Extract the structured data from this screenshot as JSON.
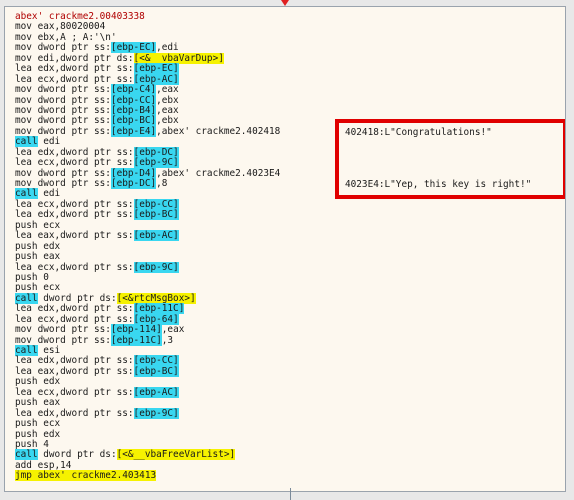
{
  "header": "abex' crackme2.00403338",
  "lines": [
    {
      "m": "mov",
      "parts": [
        {
          "t": " eax,80020004"
        }
      ]
    },
    {
      "m": "mov",
      "parts": [
        {
          "t": " ebx,A ; A:'\\n'"
        }
      ]
    },
    {
      "m": "mov",
      "parts": [
        {
          "t": " dword ptr ss:"
        },
        {
          "t": "[ebp-EC]",
          "c": "cyan"
        },
        {
          "t": ",edi"
        }
      ]
    },
    {
      "m": "mov",
      "parts": [
        {
          "t": " edi,dword ptr ds:"
        },
        {
          "t": "[<&__vbaVarDup>]",
          "c": "yellow"
        }
      ]
    },
    {
      "m": "lea",
      "parts": [
        {
          "t": " edx,dword ptr ss:"
        },
        {
          "t": "[ebp-EC]",
          "c": "cyan"
        }
      ]
    },
    {
      "m": "lea",
      "parts": [
        {
          "t": " ecx,dword ptr ss:"
        },
        {
          "t": "[ebp-AC]",
          "c": "cyan"
        }
      ]
    },
    {
      "m": "mov",
      "parts": [
        {
          "t": " dword ptr ss:"
        },
        {
          "t": "[ebp-C4]",
          "c": "cyan"
        },
        {
          "t": ",eax"
        }
      ]
    },
    {
      "m": "mov",
      "parts": [
        {
          "t": " dword ptr ss:"
        },
        {
          "t": "[ebp-CC]",
          "c": "cyan"
        },
        {
          "t": ",ebx"
        }
      ]
    },
    {
      "m": "mov",
      "parts": [
        {
          "t": " dword ptr ss:"
        },
        {
          "t": "[ebp-B4]",
          "c": "cyan"
        },
        {
          "t": ",eax"
        }
      ]
    },
    {
      "m": "mov",
      "parts": [
        {
          "t": " dword ptr ss:"
        },
        {
          "t": "[ebp-BC]",
          "c": "cyan"
        },
        {
          "t": ",ebx"
        }
      ]
    },
    {
      "m": "mov",
      "parts": [
        {
          "t": " dword ptr ss:"
        },
        {
          "t": "[ebp-E4]",
          "c": "cyan"
        },
        {
          "t": ",abex' crackme2.402418"
        }
      ],
      "comment": "402418:L\"Congratulations!\""
    },
    {
      "m": "call",
      "mc": "cyan",
      "parts": [
        {
          "t": " edi"
        }
      ]
    },
    {
      "m": "lea",
      "parts": [
        {
          "t": " edx,dword ptr ss:"
        },
        {
          "t": "[ebp-DC]",
          "c": "cyan"
        }
      ]
    },
    {
      "m": "lea",
      "parts": [
        {
          "t": " ecx,dword ptr ss:"
        },
        {
          "t": "[ebp-9C]",
          "c": "cyan"
        }
      ]
    },
    {
      "m": "mov",
      "parts": [
        {
          "t": " dword ptr ss:"
        },
        {
          "t": "[ebp-D4]",
          "c": "cyan"
        },
        {
          "t": ",abex' crackme2.4023E4"
        }
      ],
      "comment": "4023E4:L\"Yep, this key is right!\""
    },
    {
      "m": "mov",
      "parts": [
        {
          "t": " dword ptr ss:"
        },
        {
          "t": "[ebp-DC]",
          "c": "cyan"
        },
        {
          "t": ",8"
        }
      ]
    },
    {
      "m": "call",
      "mc": "cyan",
      "parts": [
        {
          "t": " edi"
        }
      ]
    },
    {
      "m": "lea",
      "parts": [
        {
          "t": " ecx,dword ptr ss:"
        },
        {
          "t": "[ebp-CC]",
          "c": "cyan"
        }
      ]
    },
    {
      "m": "lea",
      "parts": [
        {
          "t": " edx,dword ptr ss:"
        },
        {
          "t": "[ebp-BC]",
          "c": "cyan"
        }
      ]
    },
    {
      "m": "push",
      "parts": [
        {
          "t": " ecx"
        }
      ]
    },
    {
      "m": "lea",
      "parts": [
        {
          "t": " eax,dword ptr ss:"
        },
        {
          "t": "[ebp-AC]",
          "c": "cyan"
        }
      ]
    },
    {
      "m": "push",
      "parts": [
        {
          "t": " edx"
        }
      ]
    },
    {
      "m": "push",
      "parts": [
        {
          "t": " eax"
        }
      ]
    },
    {
      "m": "lea",
      "parts": [
        {
          "t": " ecx,dword ptr ss:"
        },
        {
          "t": "[ebp-9C]",
          "c": "cyan"
        }
      ]
    },
    {
      "m": "push",
      "parts": [
        {
          "t": " 0"
        }
      ]
    },
    {
      "m": "push",
      "parts": [
        {
          "t": " ecx"
        }
      ]
    },
    {
      "m": "call",
      "mc": "cyan",
      "parts": [
        {
          "t": " dword ptr ds:"
        },
        {
          "t": "[<&rtcMsgBox>]",
          "c": "yellow"
        }
      ]
    },
    {
      "m": "lea",
      "parts": [
        {
          "t": " edx,dword ptr ss:"
        },
        {
          "t": "[ebp-11C]",
          "c": "cyan"
        }
      ]
    },
    {
      "m": "lea",
      "parts": [
        {
          "t": " ecx,dword ptr ss:"
        },
        {
          "t": "[ebp-64]",
          "c": "cyan"
        }
      ]
    },
    {
      "m": "mov",
      "parts": [
        {
          "t": " dword ptr ss:"
        },
        {
          "t": "[ebp-114]",
          "c": "cyan"
        },
        {
          "t": ",eax"
        }
      ]
    },
    {
      "m": "mov",
      "parts": [
        {
          "t": " dword ptr ss:"
        },
        {
          "t": "[ebp-11C]",
          "c": "cyan"
        },
        {
          "t": ",3"
        }
      ]
    },
    {
      "m": "call",
      "mc": "cyan",
      "parts": [
        {
          "t": " esi"
        }
      ]
    },
    {
      "m": "lea",
      "parts": [
        {
          "t": " edx,dword ptr ss:"
        },
        {
          "t": "[ebp-CC]",
          "c": "cyan"
        }
      ]
    },
    {
      "m": "lea",
      "parts": [
        {
          "t": " eax,dword ptr ss:"
        },
        {
          "t": "[ebp-BC]",
          "c": "cyan"
        }
      ]
    },
    {
      "m": "push",
      "parts": [
        {
          "t": " edx"
        }
      ]
    },
    {
      "m": "lea",
      "parts": [
        {
          "t": " ecx,dword ptr ss:"
        },
        {
          "t": "[ebp-AC]",
          "c": "cyan"
        }
      ]
    },
    {
      "m": "push",
      "parts": [
        {
          "t": " eax"
        }
      ]
    },
    {
      "m": "lea",
      "parts": [
        {
          "t": " edx,dword ptr ss:"
        },
        {
          "t": "[ebp-9C]",
          "c": "cyan"
        }
      ]
    },
    {
      "m": "push",
      "parts": [
        {
          "t": " ecx"
        }
      ]
    },
    {
      "m": "push",
      "parts": [
        {
          "t": " edx"
        }
      ]
    },
    {
      "m": "push",
      "parts": [
        {
          "t": " 4"
        }
      ]
    },
    {
      "m": "call",
      "mc": "cyan",
      "parts": [
        {
          "t": " dword ptr ds:"
        },
        {
          "t": "[<&__vbaFreeVarList>]",
          "c": "yellow"
        }
      ]
    },
    {
      "m": "add",
      "parts": [
        {
          "t": " esp,14"
        }
      ]
    },
    {
      "m": "jmp",
      "mc": "yellow",
      "parts": [
        {
          "t": " abex' crackme2.403413",
          "c": "yellow"
        }
      ]
    }
  ],
  "colors": {
    "cyan": "#39d7f0",
    "yellow": "#f6f200",
    "highlight_border": "#e00000",
    "header": "#b00000"
  }
}
